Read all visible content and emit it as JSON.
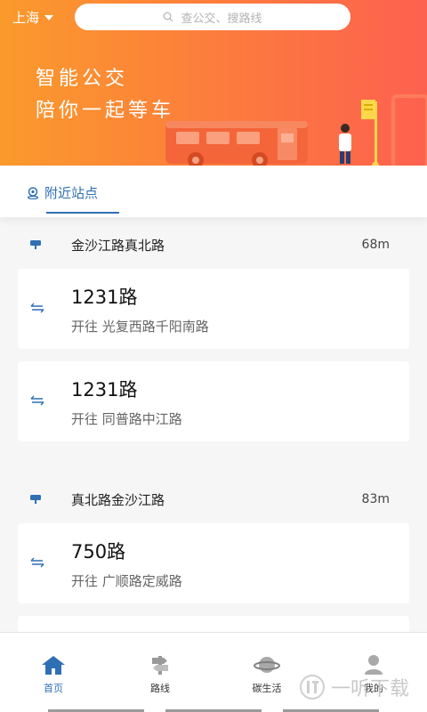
{
  "header": {
    "city": "上海",
    "search_placeholder": "查公交、搜路线",
    "slogan_line1": "智能公交",
    "slogan_line2": "陪你一起等车",
    "colors": {
      "gradient_start": "#fb9a2c",
      "gradient_end": "#fd6150"
    }
  },
  "tab": {
    "label": "附近站点",
    "icon": "location-pin-icon",
    "accent": "#2f6fb4"
  },
  "stops": [
    {
      "name": "金沙江路真北路",
      "distance": "68m",
      "routes": [
        {
          "route": "1231路",
          "destination": "开往 光复西路千阳南路"
        },
        {
          "route": "1231路",
          "destination": "开往 同普路中江路"
        }
      ]
    },
    {
      "name": "真北路金沙江路",
      "distance": "83m",
      "routes": [
        {
          "route": "750路",
          "destination": "开往 广顺路定威路"
        }
      ]
    }
  ],
  "nav": {
    "items": [
      {
        "label": "首页",
        "icon": "home-icon",
        "active": true
      },
      {
        "label": "路线",
        "icon": "route-sign-icon",
        "active": false
      },
      {
        "label": "碳生活",
        "icon": "planet-icon",
        "active": false
      },
      {
        "label": "我的",
        "icon": "user-icon",
        "active": false
      }
    ]
  },
  "watermark": "一听下载"
}
